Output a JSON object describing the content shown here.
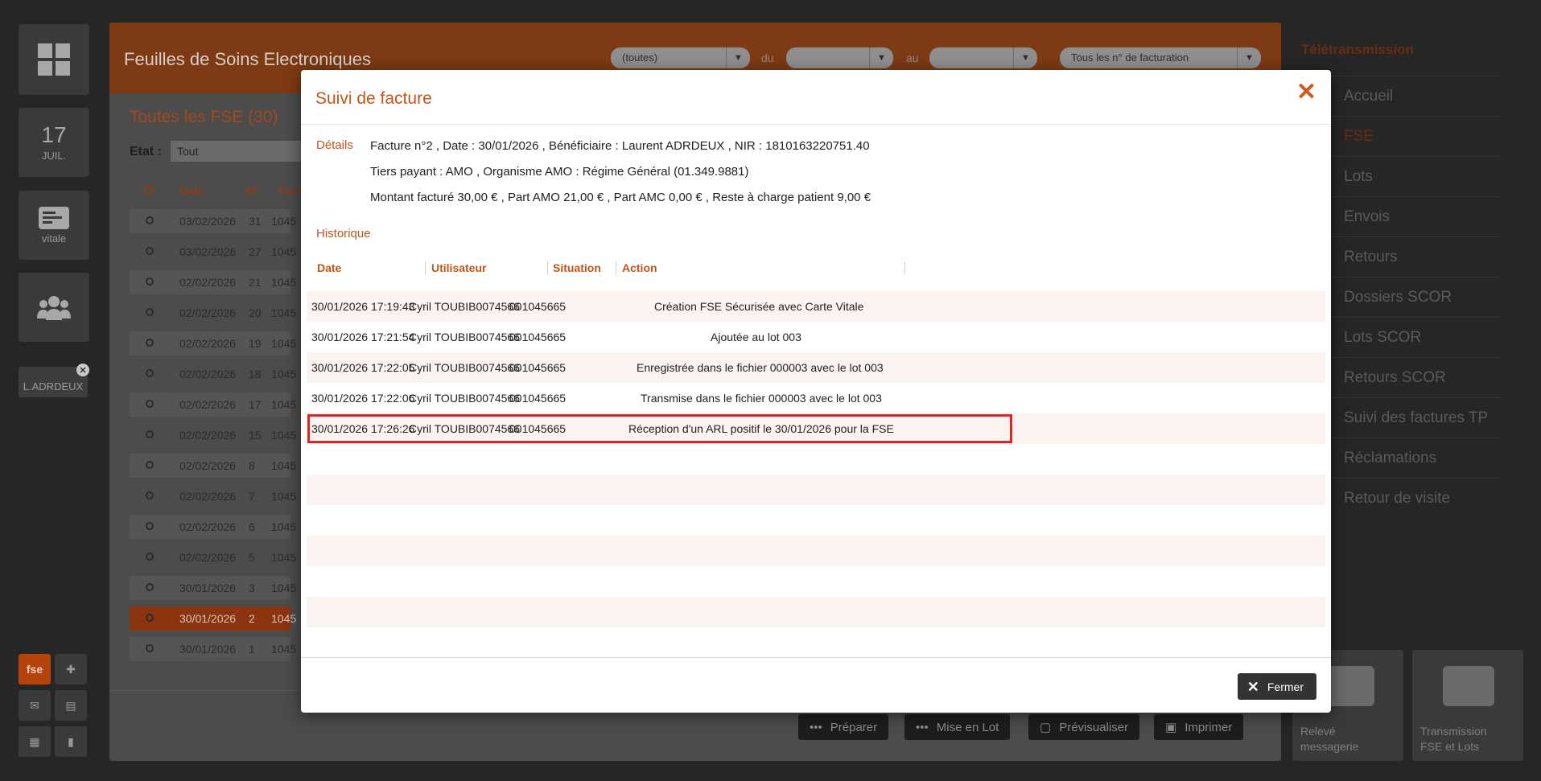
{
  "rail": {
    "calendar_day": "17",
    "calendar_month": "JUIL.",
    "vitale_label": "vitale",
    "patient_label": "L.ADRDEUX",
    "fse_label": "fse"
  },
  "background": {
    "title": "Feuilles de Soins Electroniques",
    "filter_type": "(toutes)",
    "du_label": "du",
    "au_label": "au",
    "filter_billing": "Tous les n° de facturation",
    "list_title": "Toutes les FSE (30)",
    "etat_label": "Etat :",
    "etat_value": "Tout",
    "col_date": "Date",
    "col_num": "N°",
    "col_fact": "Fact",
    "rows": [
      {
        "date": "03/02/2026",
        "num": "31",
        "fact": "1045"
      },
      {
        "date": "03/02/2026",
        "num": "27",
        "fact": "1045"
      },
      {
        "date": "02/02/2026",
        "num": "21",
        "fact": "1045"
      },
      {
        "date": "02/02/2026",
        "num": "20",
        "fact": "1045"
      },
      {
        "date": "02/02/2026",
        "num": "19",
        "fact": "1045"
      },
      {
        "date": "02/02/2026",
        "num": "18",
        "fact": "1045"
      },
      {
        "date": "02/02/2026",
        "num": "17",
        "fact": "1045"
      },
      {
        "date": "02/02/2026",
        "num": "15",
        "fact": "1045"
      },
      {
        "date": "02/02/2026",
        "num": "8",
        "fact": "1045"
      },
      {
        "date": "02/02/2026",
        "num": "7",
        "fact": "1045"
      },
      {
        "date": "02/02/2026",
        "num": "6",
        "fact": "1045"
      },
      {
        "date": "02/02/2026",
        "num": "5",
        "fact": "1045"
      },
      {
        "date": "30/01/2026",
        "num": "3",
        "fact": "1045"
      },
      {
        "date": "30/01/2026",
        "num": "2",
        "fact": "1045"
      },
      {
        "date": "30/01/2026",
        "num": "1",
        "fact": "1045"
      }
    ],
    "btn_preparer": "Préparer",
    "btn_mise_en_lot": "Mise en Lot",
    "btn_previsualiser": "Prévisualiser",
    "btn_imprimer": "Imprimer"
  },
  "right_nav": {
    "title": "Télétransmission",
    "items": [
      "Accueil",
      "FSE",
      "Lots",
      "Envois",
      "Retours",
      "Dossiers SCOR",
      "Lots SCOR",
      "Retours SCOR",
      "Suivi des factures TP",
      "Réclamations",
      "Retour de visite"
    ],
    "tile1_line1": "Relevé",
    "tile1_line2": "messagerie",
    "tile2_line1": "Transmission",
    "tile2_line2": "FSE et Lots"
  },
  "modal": {
    "title": "Suivi de facture",
    "details_label": "Détails",
    "detail_line1": "Facture n°2 , Date : 30/01/2026 , Bénéficiaire : Laurent ADRDEUX , NIR : 1810163220751.40",
    "detail_line2": "Tiers payant : AMO , Organisme AMO : Régime Général  (01.349.9881)",
    "detail_line3": "Montant facturé 30,00 € , Part AMO 21,00 € , Part AMC 0,00 € , Reste à charge patient 9,00 €",
    "historique_label": "Historique",
    "columns": {
      "date": "Date",
      "user": "Utilisateur",
      "situation": "Situation",
      "action": "Action"
    },
    "history": [
      {
        "date": "30/01/2026 17:19:43",
        "user": "Cyril TOUBIB0074566",
        "situation": "001045665",
        "action": "Création FSE Sécurisée avec Carte Vitale"
      },
      {
        "date": "30/01/2026 17:21:54",
        "user": "Cyril TOUBIB0074566",
        "situation": "001045665",
        "action": "Ajoutée au lot 003"
      },
      {
        "date": "30/01/2026 17:22:05",
        "user": "Cyril TOUBIB0074566",
        "situation": "001045665",
        "action": "Enregistrée dans le fichier 000003 avec le lot 003"
      },
      {
        "date": "30/01/2026 17:22:06",
        "user": "Cyril TOUBIB0074566",
        "situation": "001045665",
        "action": "Transmise dans le fichier 000003 avec le lot 003"
      },
      {
        "date": "30/01/2026 17:26:26",
        "user": "Cyril TOUBIB0074566",
        "situation": "001045665",
        "action": "Réception d'un ARL positif le 30/01/2026 pour la FSE"
      }
    ],
    "close_button": "Fermer",
    "accent_color": "#c2541a",
    "highlight_color": "#e02424"
  }
}
